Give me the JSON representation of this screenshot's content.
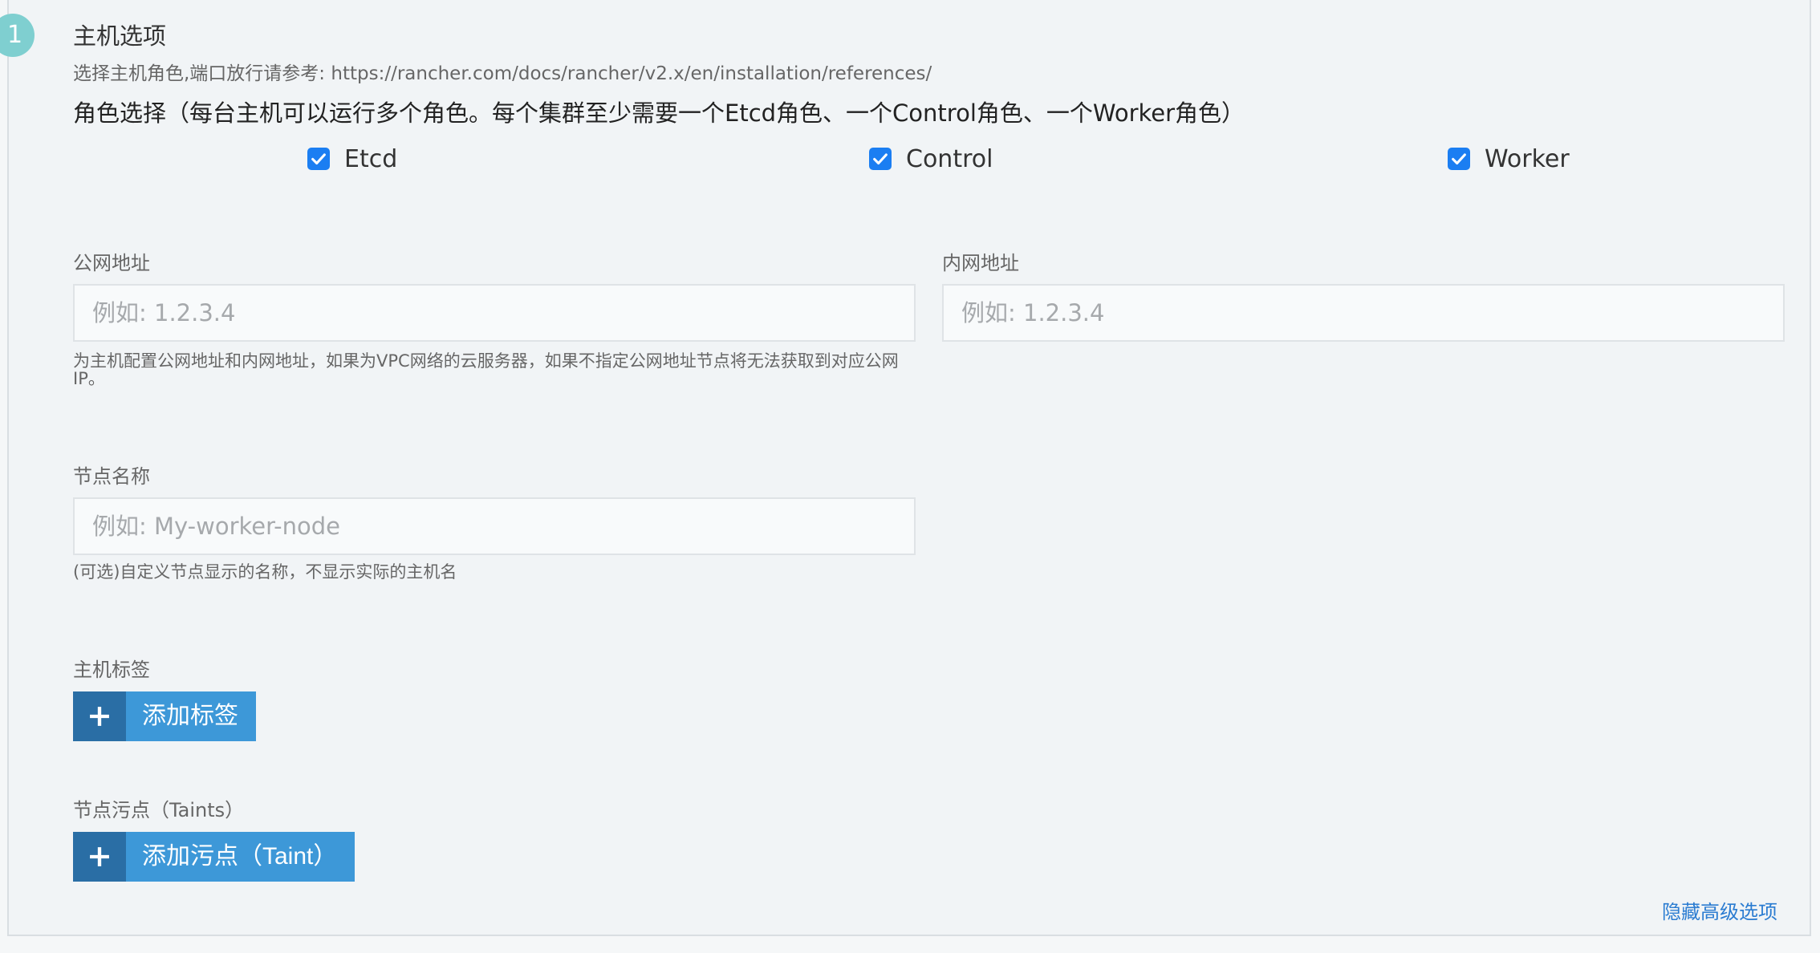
{
  "step": {
    "number": "1"
  },
  "section": {
    "title": "主机选项",
    "description": "选择主机角色,端口放行请参考: https://rancher.com/docs/rancher/v2.x/en/installation/references/"
  },
  "roles": {
    "heading": "角色选择（每台主机可以运行多个角色。每个集群至少需要一个Etcd角色、一个Control角色、一个Worker角色）",
    "items": [
      {
        "label": "Etcd",
        "checked": true
      },
      {
        "label": "Control",
        "checked": true
      },
      {
        "label": "Worker",
        "checked": true
      }
    ]
  },
  "public_address": {
    "label": "公网地址",
    "value": "",
    "placeholder": "例如: 1.2.3.4",
    "help": "为主机配置公网地址和内网地址，如果为VPC网络的云服务器，如果不指定公网地址节点将无法获取到对应公网IP。"
  },
  "internal_address": {
    "label": "内网地址",
    "value": "",
    "placeholder": "例如: 1.2.3.4"
  },
  "node_name": {
    "label": "节点名称",
    "value": "",
    "placeholder": "例如: My-worker-node",
    "help": "(可选)自定义节点显示的名称，不显示实际的主机名"
  },
  "host_labels": {
    "label": "主机标签",
    "button": "添加标签"
  },
  "taints": {
    "label": "节点污点（Taints）",
    "button": "添加污点（Taint）"
  },
  "footer": {
    "hide_advanced": "隐藏高级选项"
  },
  "colors": {
    "accent": "#3d98d8",
    "accent_dark": "#2a6ea5",
    "checkbox": "#1b7ef2",
    "badge": "#7fcfd0",
    "link": "#2b7cd1"
  }
}
